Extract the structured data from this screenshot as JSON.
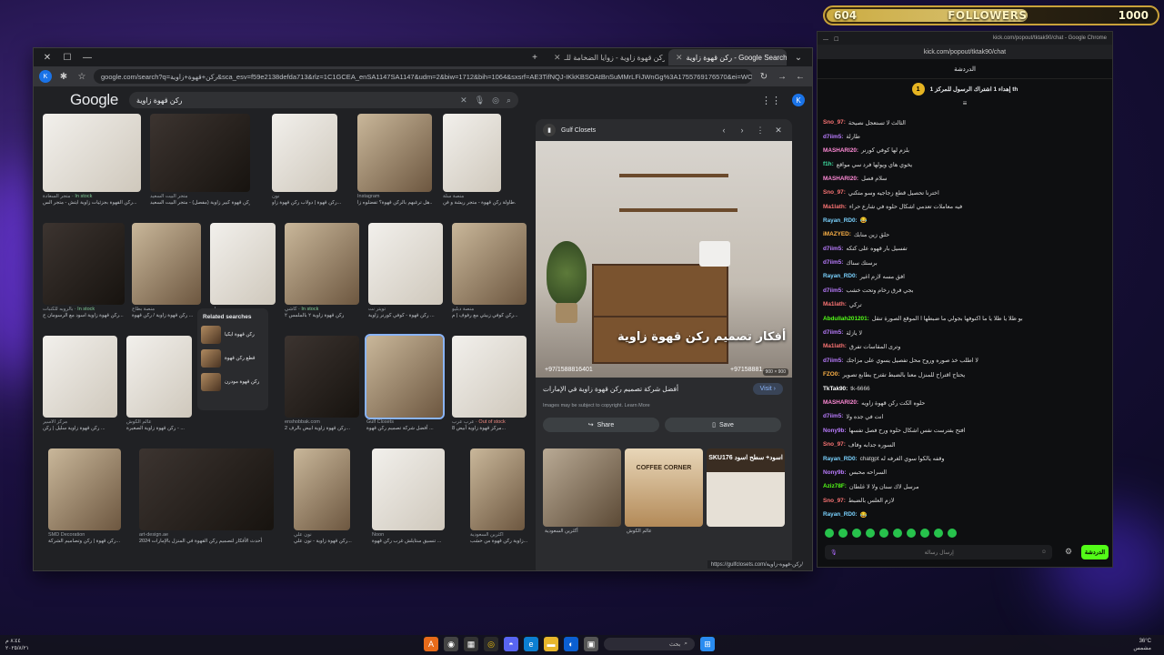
{
  "followers": {
    "current": "604",
    "label": "FOLLOWERS",
    "goal": "1000",
    "progress": 0.604
  },
  "browser": {
    "tabs": [
      {
        "label": "رکن قهوة زاوية - Google Search",
        "active": true
      },
      {
        "label": "ركن قهوة زاوية - زوايا الضخامة للـ",
        "active": false
      },
      {
        "label": "",
        "active": false
      }
    ],
    "url": "google.com/search?q=ركن+قهوة+زاوية&sca_esv=f59e2138defda713&rlz=1C1GCEA_enSA1147SA1147&udm=2&biw=1712&bih=1064&sxsrf=AE3TifNQJ-IKkKBSOAtBnSuMMrLFiJWnGg%3A1755769176570&ei=WOmma..."
  },
  "google": {
    "logo": "Google",
    "query": "ركن قهوة زاوية",
    "avatar": "K",
    "captions": [
      {
        "src": "متجر السعادة",
        "extra": "In stock",
        "extraType": "stock",
        "title": "ركن القهوة بجزئيات زاوية ايتش - متجر الس..."
      },
      {
        "src": "متجر البيت السعيد",
        "extra": "",
        "extraType": "",
        "title": "ركن قهوة كبير زاوية (مفصل) - متجر البيت السعيد"
      },
      {
        "src": "نون",
        "extra": "",
        "extraType": "",
        "title": "ركن قهوة | دولاب ركن قهوة زاو..."
      },
      {
        "src": "Instagram",
        "extra": "",
        "extraType": "",
        "title": "هل ترغبهم بالركن قهوة؟ تفضلوه زا..."
      },
      {
        "src": "منصة سلة",
        "extra": "",
        "extraType": "",
        "title": "طاولة ركن قهوة - متجر ريشة و فن..."
      },
      {
        "src": "بالروبه للكتبات",
        "extra": "In stock",
        "extraType": "stock",
        "title": "ركن قهوة زاوية اسود مع الرسومان ح..."
      },
      {
        "src": "منصة بطاح",
        "extra": "",
        "extraType": "",
        "title": "ركن قهوة زاوية / ركن قهوة ..."
      },
      {
        "src": "سلي",
        "extra": "",
        "extraType": "",
        "title": "سلي - ركن قهوة زاوية"
      },
      {
        "src": "كاشي",
        "extra": "In stock",
        "extraType": "stock",
        "title": "ركن قهوة زاوية ٢ بالملمس ٢"
      },
      {
        "src": "تويتر نت",
        "extra": "",
        "extraType": "",
        "title": "ركن قهوة - كوفي كورنر زاوية ..."
      },
      {
        "src": "منصة دبليو",
        "extra": "",
        "extraType": "",
        "title": "ركن كوفي زبيئي مع رفوف | م..."
      },
      {
        "src": "مركز الاسير",
        "extra": "",
        "extraType": "",
        "title": "ركن قهوة زاوية سليل | ركن ..."
      },
      {
        "src": "عالم الكوش",
        "extra": "",
        "extraType": "",
        "title": "ركن قهوة زاوية الصغيرة - ..."
      },
      {
        "src": "enshobbak.com",
        "extra": "",
        "extraType": "",
        "title": "ركن قهوة زاوية ابيض بالرف 2..."
      },
      {
        "src": "Gulf Closets",
        "extra": "",
        "extraType": "",
        "title": "أفضل شركة تصميم ركن قهوة ..."
      },
      {
        "src": "عرب عرب",
        "extra": "Out of stock",
        "extraType": "oos",
        "title": "مركز قهوة زاوية أبيض 8..."
      },
      {
        "src": "SMD Decoration",
        "extra": "",
        "extraType": "",
        "title": "ركن قهوة | ركن وتصاميم الشركة..."
      },
      {
        "src": "art-design.ae",
        "extra": "",
        "extraType": "",
        "title": "أحدث الأفكار لتصميم ركن القهوة في المنزل بالإمارات 2024"
      },
      {
        "src": "نون علي",
        "extra": "",
        "extraType": "",
        "title": "ركن قهوة زاوية - نون علي..."
      },
      {
        "src": "Noon",
        "extra": "",
        "extraType": "",
        "title": "تنسيق ستايلش غرب ركن قهوة ..."
      },
      {
        "src": "أكثرين السعودية",
        "extra": "",
        "extraType": "",
        "title": "زاوية ركن قهوة من خشب..."
      }
    ],
    "related": {
      "title": "Related searches",
      "items": [
        "ركن قهوة ايكيا",
        "قطع ركن قهوة",
        "ركن قهوة مودرن"
      ]
    },
    "preview": {
      "source": "Gulf Closets",
      "overlay_title": "أفكار تصميم ركن قهوة زاوية",
      "phone_left": "+97/1588816401",
      "phone_right": "+97158881...",
      "dimensions": "900 × 900",
      "caption": "أفضل شركة تصميم ركن قهوة زاوية في الإمارات",
      "visit": "Visit",
      "note": "Images may be subject to copyright. Learn More",
      "share": "Share",
      "save": "Save",
      "related_labels": [
        "",
        "COFFEE CORNER",
        "SKU176 اسود+ سطح اسود"
      ],
      "related_caps": [
        "أكثرين السعودية",
        "عالم الكوش",
        ""
      ]
    },
    "status_url": "https://gulfclosets.com/ركن-قهوة-زاوية/"
  },
  "chat": {
    "window_title": "kick.com/popout/tktak90/chat - Google Chrome",
    "url": "kick.com/popout/tktak90/chat",
    "header": "الدردشة",
    "pinned": "إهداء 1 اشتراك الرسول للمركز 1 th",
    "messages": [
      {
        "user": "Sno_97",
        "color": "#f97373",
        "text": "الثالث لا تستعجل نصيحة"
      },
      {
        "user": "d7iim5",
        "color": "#ba7cff",
        "text": "طارلة"
      },
      {
        "user": "MASHARI20",
        "color": "#ff8ad6",
        "text": "بلزم لها كوفي كورنر"
      },
      {
        "user": "f1h",
        "color": "#3ee0a2",
        "text": "يخوي هاي ويولها فرد سي مواقع"
      },
      {
        "user": "MASHARI20",
        "color": "#ff8ad6",
        "text": "سلام فصل"
      },
      {
        "user": "Sno_97",
        "color": "#f97373",
        "text": "اخترنا تحصيل قطع زجاجيه وسو متكني"
      },
      {
        "user": "Ma1lath",
        "color": "#f97373",
        "text": "فيه معاملات تعدمي اشكال حلوه في شارع حراء"
      },
      {
        "user": "Rayan_RD0",
        "color": "#7ad2ff",
        "text": "😂"
      },
      {
        "user": "iMAZYED",
        "color": "#ffb347",
        "text": "حلق زين منابك"
      },
      {
        "user": "d7iim5",
        "color": "#ba7cff",
        "text": "تفسيل بار قهوه على كتكه"
      },
      {
        "user": "d7iim5",
        "color": "#ba7cff",
        "text": "برستك سناك"
      },
      {
        "user": "Rayan_RD0",
        "color": "#7ad2ff",
        "text": "افق مسه لازم اغير"
      },
      {
        "user": "d7iim5",
        "color": "#ba7cff",
        "text": "بجي فرق رخام وتحت خشب"
      },
      {
        "user": "Ma1lath",
        "color": "#f97373",
        "text": "تركي"
      },
      {
        "user": "Abdullah201201",
        "color": "#53fc18",
        "text": "بو ظلا يا ظلا يا ما اكنوفها بجولي ما ضبطها ا الموقع الصورة تنقل"
      },
      {
        "user": "d7iim5",
        "color": "#ba7cff",
        "text": "لا يازلة"
      },
      {
        "user": "Ma1lath",
        "color": "#f97373",
        "text": "وترى المقاسات تفرق"
      },
      {
        "user": "d7iim5",
        "color": "#ba7cff",
        "text": "لا اطلب خذ صوره وروح محل تفصيل يسوي على مزاجك"
      },
      {
        "user": "FZO0",
        "color": "#ffb347",
        "text": "يحتاج اقتراح للمنزل معنا بالضبط تقترح بطابع تصوير"
      },
      {
        "user": "TkTak90",
        "color": "#ffffff",
        "text": "tk-6666"
      },
      {
        "user": "MASHARI20",
        "color": "#ff8ad6",
        "text": "حلوه الكت ركن قهوة زاويه"
      },
      {
        "user": "d7iim5",
        "color": "#ba7cff",
        "text": "انت في جده ولا"
      },
      {
        "user": "Nony9b",
        "color": "#ba7cff",
        "text": "افتح بفترست نفس اشكال حلوه ورح فصل تفسها"
      },
      {
        "user": "Sno_97",
        "color": "#f97373",
        "text": "السوره جدابه وفاف"
      },
      {
        "user": "Rayan_RD0",
        "color": "#7ad2ff",
        "text": "chatgpt وقفه يالكوا سوي الغرفه له"
      },
      {
        "user": "Nony9b",
        "color": "#ba7cff",
        "text": "السراحه محبس"
      },
      {
        "user": "Aziz78F",
        "color": "#53fc18",
        "text": "مرسل لاك سنان ولا لا غلطان"
      },
      {
        "user": "Sno_97",
        "color": "#f97373",
        "text": "لازم العلس بالضبط"
      },
      {
        "user": "Rayan_RD0",
        "color": "#7ad2ff",
        "text": "😂"
      }
    ],
    "input_placeholder": "إرسال رسالة",
    "send": "الدردشة"
  },
  "taskbar": {
    "search": "بحث",
    "time": "٨:٤٤ م",
    "date": "٢٠٢٥/٨/٢١",
    "weather": "36°C",
    "weather_desc": "مشمس"
  }
}
